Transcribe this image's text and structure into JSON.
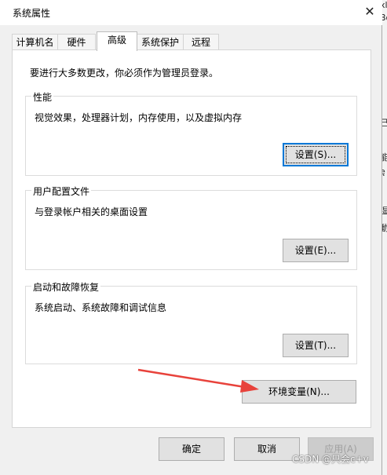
{
  "dialog": {
    "title": "系统属性",
    "close_glyph": "✕"
  },
  "tabs": [
    {
      "label": "计算机名"
    },
    {
      "label": "硬件"
    },
    {
      "label": "高级"
    },
    {
      "label": "系统保护"
    },
    {
      "label": "远程"
    }
  ],
  "active_tab": "高级",
  "intro": "要进行大多数更改，你必须作为管理员登录。",
  "performance": {
    "title": "性能",
    "description": "视觉效果，处理器计划，内存使用，以及虚拟内存",
    "button": "设置(S)..."
  },
  "user_profiles": {
    "title": "用户配置文件",
    "description": "与登录帐户相关的桌面设置",
    "button": "设置(E)..."
  },
  "startup_recovery": {
    "title": "启动和故障恢复",
    "description": "系统启动、系统故障和调试信息",
    "button": "设置(T)..."
  },
  "env_button": "环境变量(N)...",
  "footer": {
    "ok": "确定",
    "cancel": "取消",
    "apply": "应用(A)"
  },
  "watermark": "CSDN @只会c+v",
  "background_fragments": {
    "right": [
      "xl",
      "Bo",
      "己",
      "能",
      "ę",
      "湿",
      "動"
    ],
    "left": [
      "约"
    ]
  },
  "colors": {
    "accent": "#0078d7",
    "arrow": "#e8423b",
    "dialog_bg": "#f0f0f0"
  }
}
